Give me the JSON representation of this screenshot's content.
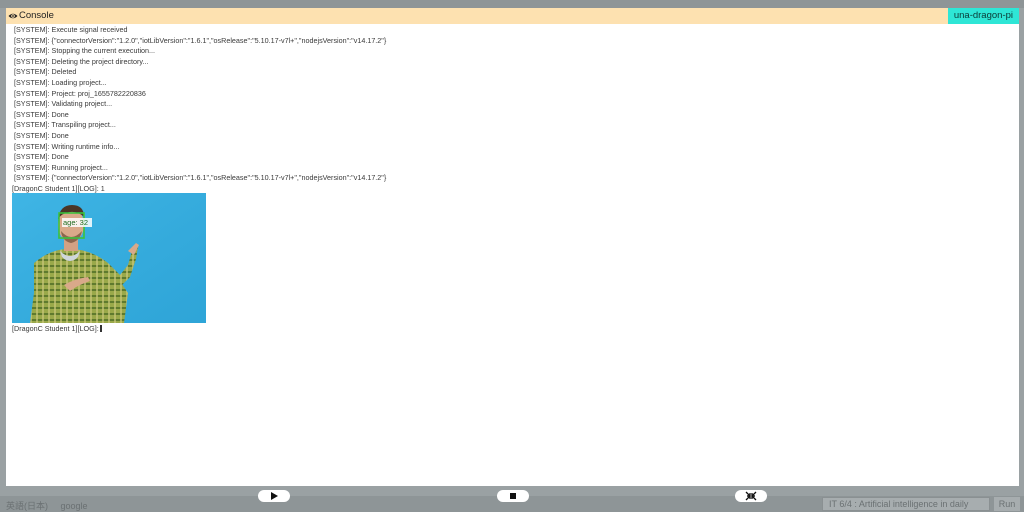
{
  "console": {
    "title": "Console",
    "device_badge": "una-dragon-pi",
    "system_lines": [
      "[SYSTEM]: Execute signal received",
      "[SYSTEM]: {\"connectorVersion\":\"1.2.0\",\"iotLibVersion\":\"1.6.1\",\"osRelease\":\"5.10.17-v7l+\",\"nodejsVersion\":\"v14.17.2\"}",
      "[SYSTEM]: Stopping the current execution...",
      "[SYSTEM]: Deleting the project directory...",
      "[SYSTEM]: Deleted",
      "[SYSTEM]: Loading project...",
      "[SYSTEM]: Project: proj_1655782220836",
      "[SYSTEM]: Validating project...",
      "[SYSTEM]: Done",
      "[SYSTEM]: Transpiling project...",
      "[SYSTEM]: Done",
      "[SYSTEM]: Writing runtime info...",
      "[SYSTEM]: Done",
      "[SYSTEM]: Running project...",
      "[SYSTEM]: {\"connectorVersion\":\"1.2.0\",\"iotLibVersion\":\"1.6.1\",\"osRelease\":\"5.10.17-v7l+\",\"nodejsVersion\":\"v14.17.2\"}"
    ],
    "log_line_1": "[DragonC Student 1][LOG]: 1",
    "detection_label": "age: 32",
    "log_line_2": "[DragonC Student 1][LOG]:"
  },
  "background": {
    "bottom_left": [
      "英語(日本)",
      "google"
    ],
    "select_label": "IT 6/4 : Artificial intelligence in daily",
    "button_label": "Run"
  },
  "controls": {
    "play_icon": "play-icon",
    "stop_icon": "stop-icon",
    "collapse_icon": "collapse-icon"
  },
  "colors": {
    "header_bg": "#fde1b0",
    "badge_bg": "#2ee6d6",
    "image_bg": "#35aee0",
    "box_color": "#3cc13c"
  }
}
